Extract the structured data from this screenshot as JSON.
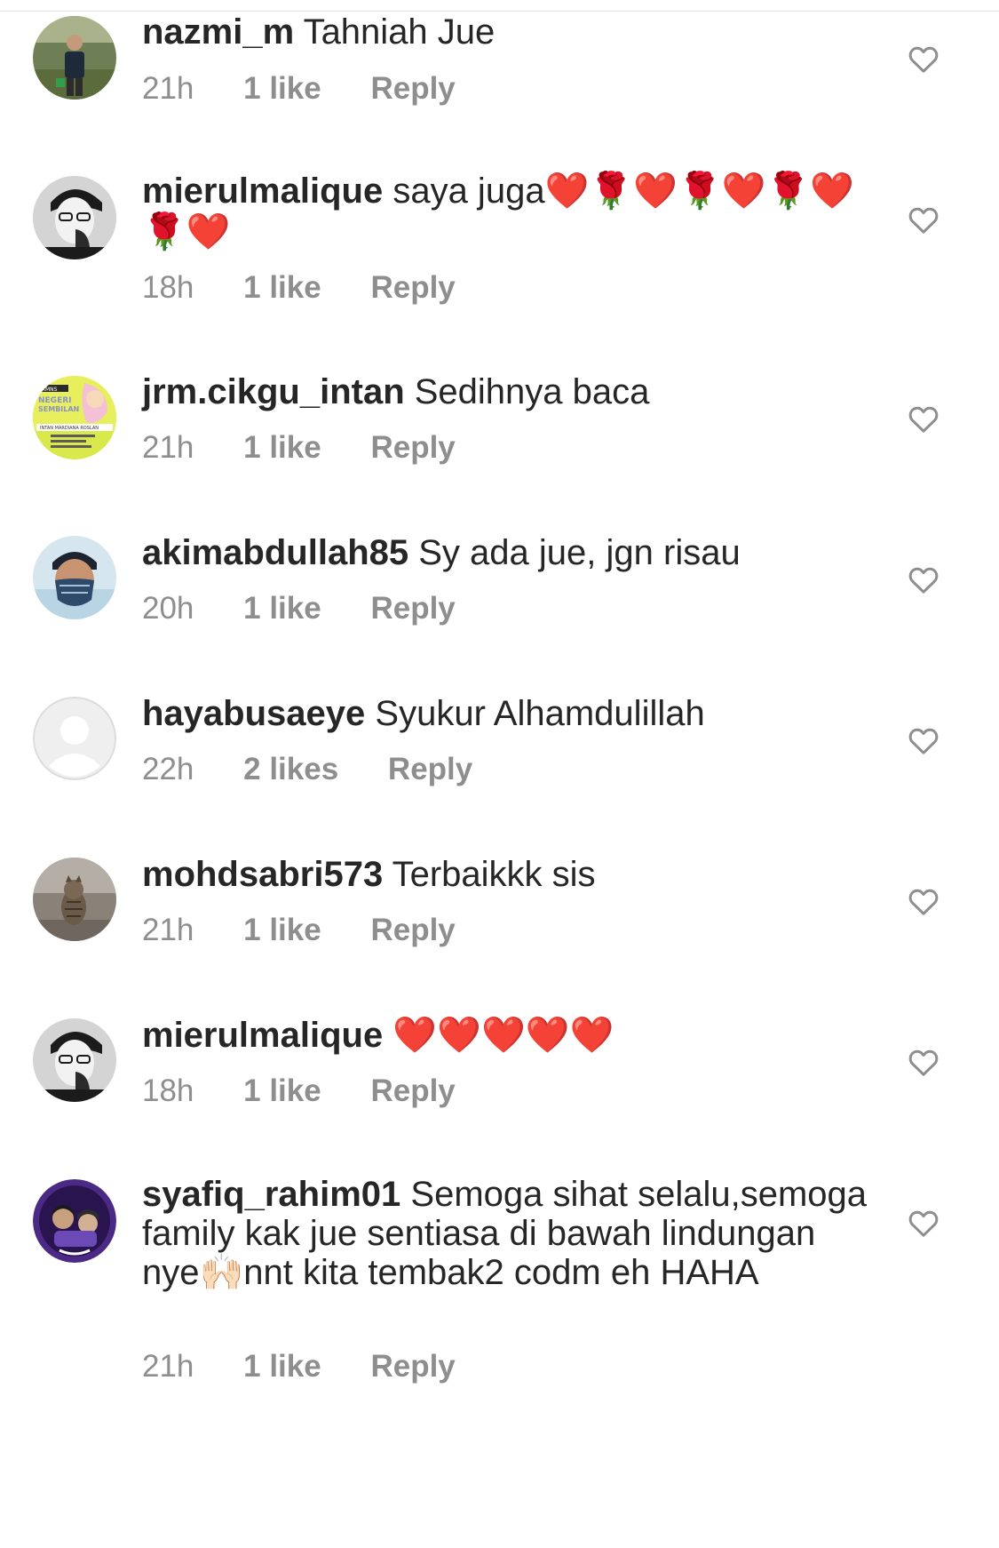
{
  "comments": [
    {
      "username": "nazmi_m",
      "text": "Tahniah Jue",
      "time": "21h",
      "likes": "1 like",
      "reply": "Reply"
    },
    {
      "username": "mierulmalique",
      "text": "saya juga❤️🌹❤️🌹❤️🌹❤️🌹❤️",
      "time": "18h",
      "likes": "1 like",
      "reply": "Reply"
    },
    {
      "username": "jrm.cikgu_intan",
      "text": "Sedihnya baca",
      "time": "21h",
      "likes": "1 like",
      "reply": "Reply",
      "avatar_lines": [
        "JRMNS",
        "NEGERI",
        "SEMBILAN",
        "INTAN MARDIANA ROSLAN"
      ]
    },
    {
      "username": "akimabdullah85",
      "text": "Sy ada jue, jgn risau",
      "time": "20h",
      "likes": "1 like",
      "reply": "Reply"
    },
    {
      "username": "hayabusaeye",
      "text": "Syukur Alhamdulillah",
      "time": "22h",
      "likes": "2 likes",
      "reply": "Reply"
    },
    {
      "username": "mohdsabri573",
      "text": "Terbaikkk sis",
      "time": "21h",
      "likes": "1 like",
      "reply": "Reply"
    },
    {
      "username": "mierulmalique",
      "text": " ❤️❤️❤️❤️❤️",
      "time": "18h",
      "likes": "1 like",
      "reply": "Reply"
    },
    {
      "username": "syafiq_rahim01",
      "text": "Semoga sihat selalu,semoga family kak jue sentiasa di bawah lindungan nye🙌🏻nnt kita tembak2 codm eh HAHA",
      "time": "21h",
      "likes": "1 like",
      "reply": "Reply"
    }
  ],
  "colors": {
    "text": "#262626",
    "meta": "#8e8e8e",
    "heart_outline": "#8e8e8e",
    "background": "#ffffff"
  },
  "icons": {
    "like": "heart-outline-icon"
  }
}
